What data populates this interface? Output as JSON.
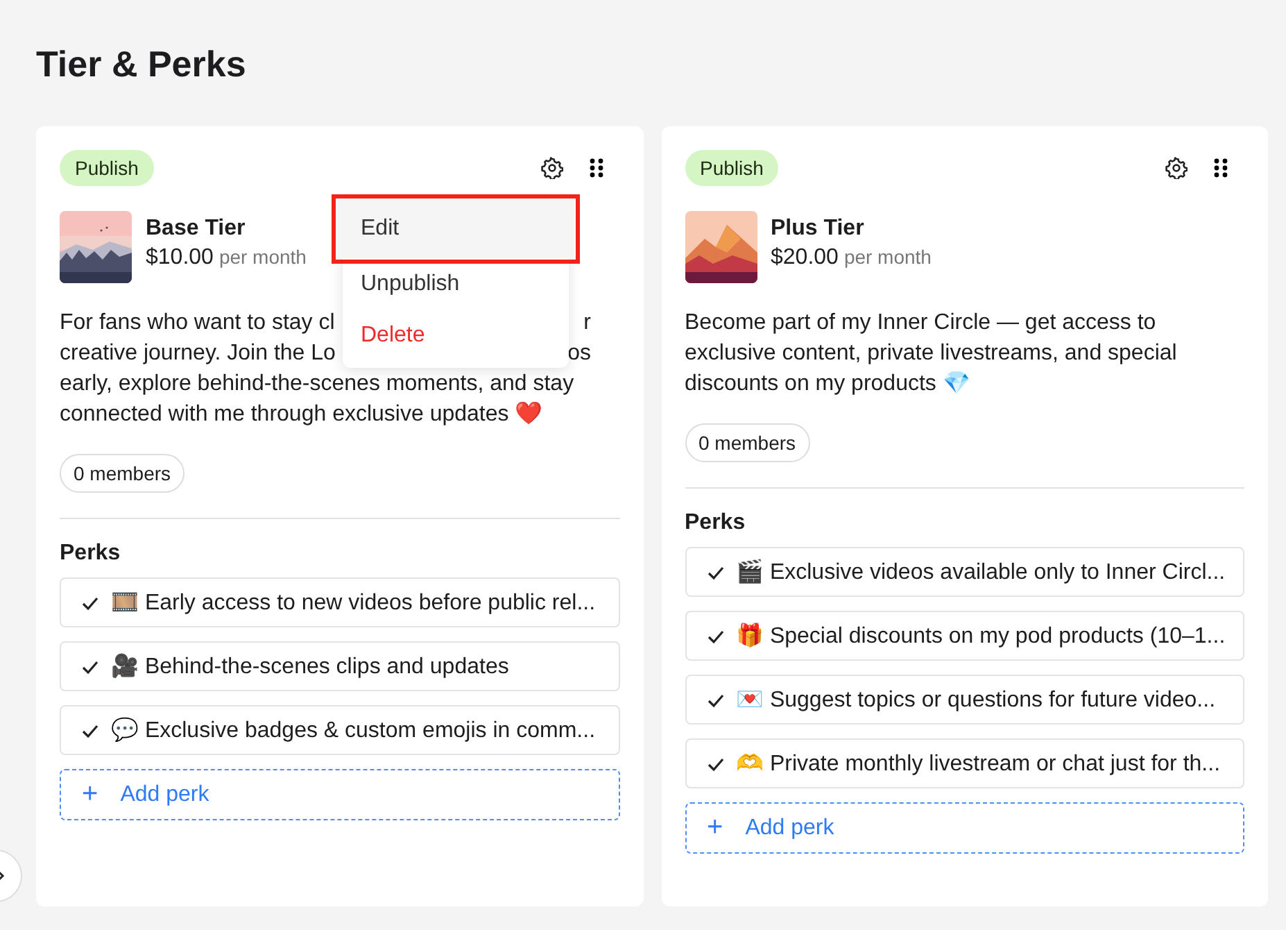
{
  "page": {
    "title": "Tier & Perks"
  },
  "tiers": [
    {
      "status": "Publish",
      "name": "Base Tier",
      "price": "$10.00",
      "period": "per month",
      "description_lines": [
        {
          "text": "For fans who want to stay cl",
          "tail": "r"
        },
        {
          "text": "creative journey. Join the Lo",
          "tail": "os"
        },
        {
          "text": "early, explore behind-the-scenes moments, and stay"
        },
        {
          "text": "connected with me through exclusive updates ❤️"
        }
      ],
      "members": "0 members",
      "perks_title": "Perks",
      "perks": [
        {
          "text": "🎞️ Early access to new videos before public rel..."
        },
        {
          "text": "🎥 Behind-the-scenes clips and updates"
        },
        {
          "text": "💬 Exclusive badges & custom emojis in comm..."
        }
      ],
      "add_perk": {
        "icon": "+",
        "label": "Add perk"
      },
      "menu": [
        {
          "label": "Edit",
          "kind": "normal",
          "hovered": true,
          "highlighted": true
        },
        {
          "label": "Unpublish",
          "kind": "normal",
          "hovered": false,
          "highlighted": false
        },
        {
          "label": "Delete",
          "kind": "danger",
          "hovered": false,
          "highlighted": false
        }
      ]
    },
    {
      "status": "Publish",
      "name": "Plus Tier",
      "price": "$20.00",
      "period": "per month",
      "description_lines": [
        {
          "text": "Become part of my Inner Circle — get access to"
        },
        {
          "text": "exclusive content, private livestreams, and special"
        },
        {
          "text": "discounts on my products 💎"
        }
      ],
      "members": "0 members",
      "perks_title": "Perks",
      "perks": [
        {
          "text": "🎬 Exclusive videos available only to Inner Circl..."
        },
        {
          "text": "🎁 Special discounts on my pod products (10–1..."
        },
        {
          "text": "💌 Suggest topics or questions for future video..."
        },
        {
          "text": "🫶 Private monthly livestream or chat just for th..."
        }
      ],
      "add_perk": {
        "icon": "+",
        "label": "Add perk"
      }
    }
  ]
}
